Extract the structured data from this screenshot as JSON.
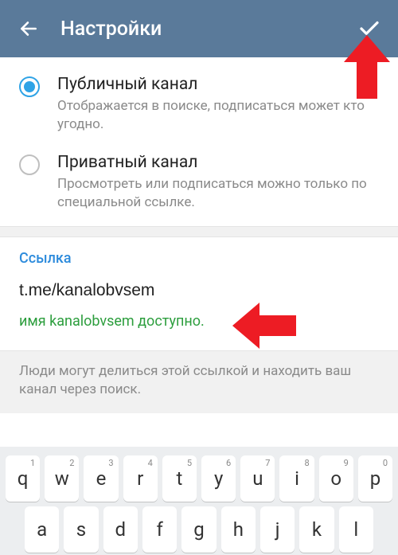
{
  "header": {
    "title": "Настройки"
  },
  "channel_type": {
    "public": {
      "label": "Публичный канал",
      "desc": "Отображается в поиске, подписаться может кто угодно."
    },
    "private": {
      "label": "Приватный канал",
      "desc": "Просмотреть или подписаться можно только по специальной ссылке."
    }
  },
  "link": {
    "section_label": "Ссылка",
    "value": "t.me/kanalobvsem",
    "status": "имя kanalobvsem доступно.",
    "hint": "Люди могут делиться этой ссылкой и находить ваш канал через поиск."
  },
  "keyboard": {
    "row1": [
      {
        "c": "q",
        "n": "1"
      },
      {
        "c": "w",
        "n": "2"
      },
      {
        "c": "e",
        "n": "3"
      },
      {
        "c": "r",
        "n": "4"
      },
      {
        "c": "t",
        "n": "5"
      },
      {
        "c": "y",
        "n": "6"
      },
      {
        "c": "u",
        "n": "7"
      },
      {
        "c": "i",
        "n": "8"
      },
      {
        "c": "o",
        "n": "9"
      },
      {
        "c": "p",
        "n": "0"
      }
    ],
    "row2": [
      {
        "c": "a"
      },
      {
        "c": "s"
      },
      {
        "c": "d"
      },
      {
        "c": "f"
      },
      {
        "c": "g"
      },
      {
        "c": "h"
      },
      {
        "c": "j"
      },
      {
        "c": "k"
      },
      {
        "c": "l"
      }
    ]
  },
  "colors": {
    "accent": "#5a7a9a",
    "radio": "#2fa3e6",
    "link": "#2d8bdc",
    "success": "#2d9e3e",
    "arrow": "#ed1c24"
  }
}
